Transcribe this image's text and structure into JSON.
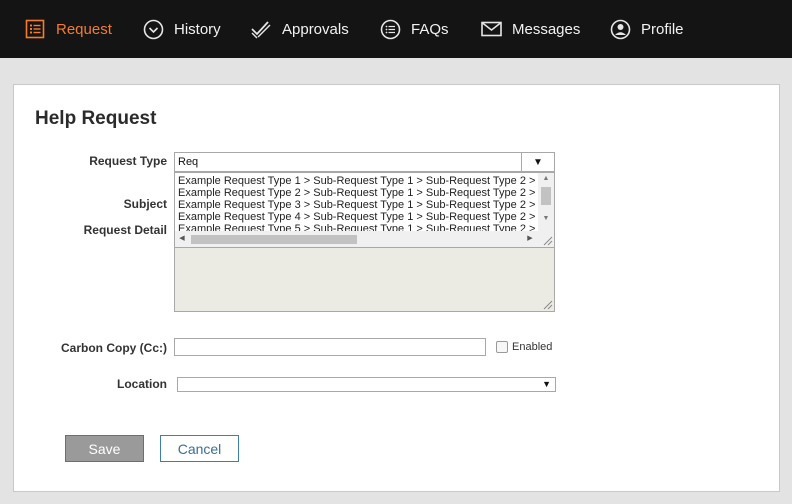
{
  "nav": {
    "items": [
      {
        "label": "Request",
        "icon": "list-icon",
        "active": true
      },
      {
        "label": "History",
        "icon": "chevron-circle-icon"
      },
      {
        "label": "Approvals",
        "icon": "double-check-icon"
      },
      {
        "label": "FAQs",
        "icon": "list-circle-icon"
      },
      {
        "label": "Messages",
        "icon": "envelope-icon"
      },
      {
        "label": "Profile",
        "icon": "user-circle-icon"
      }
    ],
    "active_color": "#f47c2c"
  },
  "form": {
    "title": "Help Request",
    "request_type": {
      "label": "Request Type",
      "value": "Req",
      "button_glyph": "▼",
      "options": [
        "Example Request Type 1 > Sub-Request Type 1 > Sub-Request Type 2 >",
        "Example Request Type 2 > Sub-Request Type 1 > Sub-Request Type 2 >",
        "Example Request Type 3 > Sub-Request Type 1 > Sub-Request Type 2 >",
        "Example Request Type 4 > Sub-Request Type 1 > Sub-Request Type 2 >",
        "Example Request Type 5 > Sub-Request Type 1 > Sub-Request Type 2 >"
      ]
    },
    "subject_label": "Subject",
    "request_detail_label": "Request Detail",
    "cc": {
      "label": "Carbon Copy (Cc:)",
      "value": "",
      "checkbox_label": "Enabled",
      "checked": false
    },
    "location": {
      "label": "Location",
      "value": "",
      "caret": "▼"
    },
    "buttons": {
      "save": "Save",
      "cancel": "Cancel"
    }
  }
}
